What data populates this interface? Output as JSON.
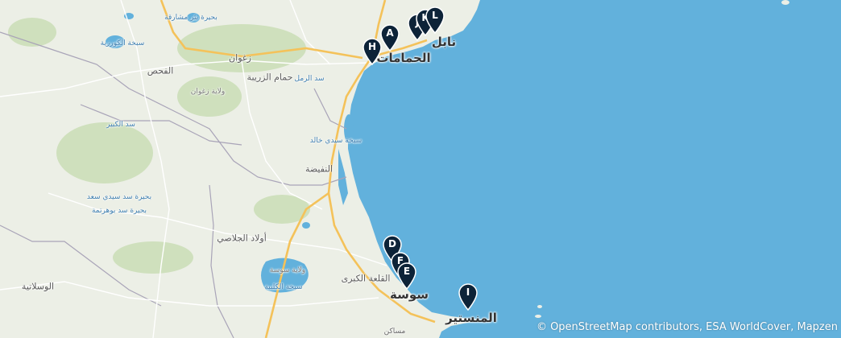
{
  "map": {
    "attribution": "© OpenStreetMap contributors, ESA WorldCover, Mapzen",
    "colors": {
      "sea": "#62b1dc",
      "land": "#ecefe6",
      "forest": "#cfe0bd",
      "road_major": "#f4c25a",
      "road_minor": "#ffffff",
      "boundary": "#a9a4b8",
      "marker": "#0d2338"
    },
    "places": [
      {
        "key": "hammamet",
        "name": "الحمامات",
        "kind": "city"
      },
      {
        "key": "nabeul",
        "name": "نابل",
        "kind": "city"
      },
      {
        "key": "sousse",
        "name": "سوسة",
        "kind": "city"
      },
      {
        "key": "monastir",
        "name": "المنستير",
        "kind": "city"
      },
      {
        "key": "zaghouan",
        "name": "زغوان",
        "kind": "town"
      },
      {
        "key": "zaghouan_gov",
        "name": "ولاية زغوان",
        "kind": "region"
      },
      {
        "key": "hammam_zriba",
        "name": "حمام الزريبة",
        "kind": "town"
      },
      {
        "key": "el_fahs",
        "name": "الفحص",
        "kind": "town"
      },
      {
        "key": "nfidha",
        "name": "النفيضة",
        "kind": "town"
      },
      {
        "key": "ouled_jelleh",
        "name": "أولاد الجلاصي",
        "kind": "town"
      },
      {
        "key": "kalaa_kebira",
        "name": "القلعة الكبرى",
        "kind": "town"
      },
      {
        "key": "sousse_gov",
        "name": "ولاية سوسة",
        "kind": "region"
      },
      {
        "key": "msaken",
        "name": "مساكن",
        "kind": "small"
      },
      {
        "key": "ouesslatia",
        "name": "الوسلاتية",
        "kind": "town"
      },
      {
        "key": "sebkha_kelbia",
        "name": "سبخة الكلبية",
        "kind": "water"
      },
      {
        "key": "sebkha_sidi_khalifa",
        "name": "سبخة سيدي خالد",
        "kind": "water"
      },
      {
        "key": "sebkha_kourzia",
        "name": "سبخة الكورزية",
        "kind": "water"
      },
      {
        "key": "bouhertma",
        "name": "بحيرة سد بوهرتمة",
        "kind": "water"
      },
      {
        "key": "sidi_saad",
        "name": "بحيرة سد سيدي سعد",
        "kind": "water"
      },
      {
        "key": "bir_mcherga",
        "name": "بحيرة بئر مشارقة",
        "kind": "water"
      },
      {
        "key": "sed_ramel",
        "name": "سد الرمل",
        "kind": "water"
      },
      {
        "key": "sed_kebir",
        "name": "سد الكبير",
        "kind": "water"
      }
    ],
    "markers": [
      {
        "key": "A",
        "label": "A"
      },
      {
        "key": "H",
        "label": "H"
      },
      {
        "key": "J",
        "label": "J"
      },
      {
        "key": "K",
        "label": "K"
      },
      {
        "key": "L",
        "label": "L"
      },
      {
        "key": "D",
        "label": "D"
      },
      {
        "key": "F",
        "label": "F"
      },
      {
        "key": "E",
        "label": "E"
      },
      {
        "key": "I",
        "label": "I"
      }
    ]
  }
}
